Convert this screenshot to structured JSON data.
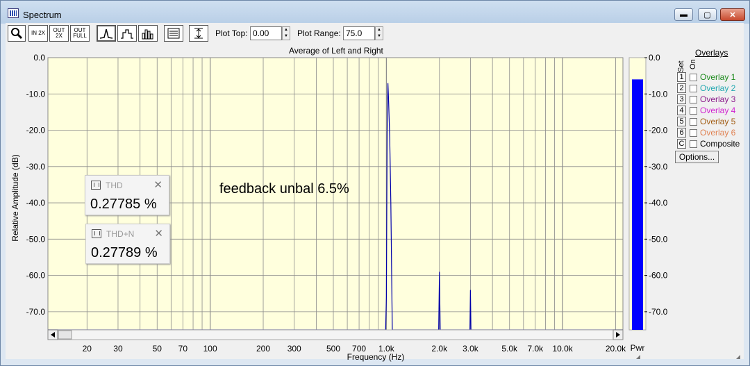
{
  "window": {
    "title": "Spectrum",
    "buttons": {
      "minimize": "▬",
      "maximize": "▢",
      "close": "✕"
    }
  },
  "toolbar": {
    "zoom_icon": "magnifier-icon",
    "zoom_in_label": "IN 2X",
    "zoom_out_label": "OUT 2X",
    "zoom_full_label": "OUT FULL",
    "plot_top_label": "Plot Top:",
    "plot_top_value": "0.00",
    "plot_range_label": "Plot Range:",
    "plot_range_value": "75.0"
  },
  "chart_data": {
    "type": "line",
    "title": "Average of Left and Right",
    "xlabel": "Frequency (Hz)",
    "ylabel": "Relative Amplitude (dB)",
    "x_scale": "log",
    "xlim": [
      12,
      22000
    ],
    "ylim": [
      -75,
      0
    ],
    "y_ticks": [
      "0.0",
      "-10.0",
      "-20.0",
      "-30.0",
      "-40.0",
      "-50.0",
      "-60.0",
      "-70.0"
    ],
    "x_ticks": [
      "20",
      "30",
      "50",
      "70",
      "100",
      "200",
      "300",
      "500",
      "700",
      "1.0k",
      "2.0k",
      "3.0k",
      "5.0k",
      "7.0k",
      "10.0k",
      "20.0k"
    ],
    "x_tick_values": [
      20,
      30,
      50,
      70,
      100,
      200,
      300,
      500,
      700,
      1000,
      2000,
      3000,
      5000,
      7000,
      10000,
      20000
    ],
    "grid": true,
    "background": "#ffffdd",
    "series": [
      {
        "color": "#0000aa",
        "points": [
          [
            12,
            -75
          ],
          [
            990,
            -75
          ],
          [
            1000,
            -66
          ],
          [
            1010,
            -20
          ],
          [
            1020,
            -7
          ],
          [
            1030,
            -12
          ],
          [
            1045,
            -22
          ],
          [
            1060,
            -40
          ],
          [
            1080,
            -75
          ],
          [
            1980,
            -75
          ],
          [
            2000,
            -59
          ],
          [
            2020,
            -75
          ],
          [
            2980,
            -75
          ],
          [
            3000,
            -64
          ],
          [
            3020,
            -75
          ],
          [
            22000,
            -75
          ]
        ]
      }
    ],
    "power_bar": {
      "label": "Pwr",
      "level_db": -6,
      "color": "#0000ff",
      "ticks": [
        "0.0",
        "-10.0",
        "-20.0",
        "-30.0",
        "-40.0",
        "-50.0",
        "-60.0",
        "-70.0"
      ]
    }
  },
  "readouts": [
    {
      "title": "THD",
      "value": "0.27785 %"
    },
    {
      "title": "THD+N",
      "value": "0.27789 %"
    }
  ],
  "annotation": "feedback unbal 6.5%",
  "overlays": {
    "header": "Overlays",
    "set_label": "Set",
    "on_label": "On",
    "items": [
      {
        "num": "1",
        "label": "Overlay 1",
        "color": "#1b8a1b"
      },
      {
        "num": "2",
        "label": "Overlay 2",
        "color": "#22a8b0"
      },
      {
        "num": "3",
        "label": "Overlay 3",
        "color": "#8a1a8a"
      },
      {
        "num": "4",
        "label": "Overlay 4",
        "color": "#d020d0"
      },
      {
        "num": "5",
        "label": "Overlay 5",
        "color": "#a05a10"
      },
      {
        "num": "6",
        "label": "Overlay 6",
        "color": "#e08050"
      },
      {
        "num": "C",
        "label": "Composite",
        "color": "#000000"
      }
    ],
    "options_label": "Options..."
  }
}
